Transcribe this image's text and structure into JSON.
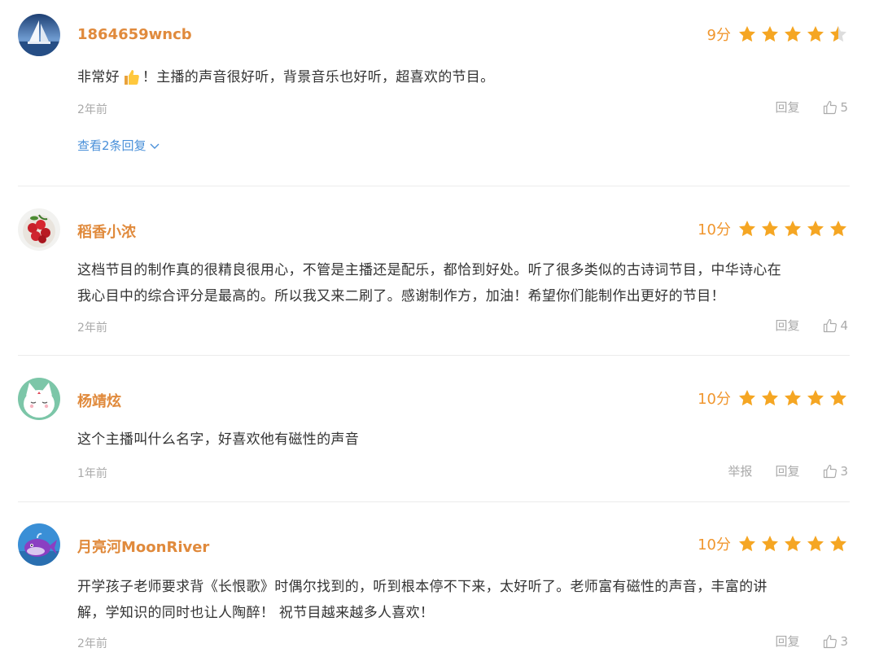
{
  "comments": [
    {
      "username": "1864659wncb",
      "score": "9分",
      "stars": 4.5,
      "content_before": "非常好",
      "content_emoji": "thumbs-up",
      "content_after": "！主播的声音很好听，背景音乐也好听，超喜欢的节目。",
      "time": "2年前",
      "reply_label": "回复",
      "likes": "5",
      "view_replies": "查看2条回复",
      "avatar_icon": "sailboat-icon"
    },
    {
      "username": "稻香小浓",
      "score": "10分",
      "stars": 5,
      "content_line1": "这档节目的制作真的很精良很用心，不管是主播还是配乐，都恰到好处。听了很多类似的古诗词节目，中华诗心在",
      "content_line2": "我心目中的综合评分是最高的。所以我又来二刷了。感谢制作方，加油！希望你们能制作出更好的节目！",
      "time": "2年前",
      "reply_label": "回复",
      "likes": "4",
      "avatar_icon": "cherries-icon"
    },
    {
      "username": "杨靖炫",
      "score": "10分",
      "stars": 5,
      "content": "这个主播叫什么名字，好喜欢他有磁性的声音",
      "time": "1年前",
      "report_label": "举报",
      "reply_label": "回复",
      "likes": "3",
      "avatar_icon": "cat-icon"
    },
    {
      "username": "月亮河MoonRiver",
      "score": "10分",
      "stars": 5,
      "content_line1": "开学孩子老师要求背《长恨歌》时偶尔找到的，听到根本停不下来，太好听了。老师富有磁性的声音，丰富的讲",
      "content_line2": "解，学知识的同时也让人陶醉！ 祝节目越来越多人喜欢！",
      "time": "2年前",
      "reply_label": "回复",
      "likes": "3",
      "avatar_icon": "whale-icon"
    }
  ],
  "colors": {
    "username": "#e08a3c",
    "score": "#f0962e",
    "star": "#f5a623",
    "link": "#4a90d9",
    "muted": "#aaaaaa"
  }
}
